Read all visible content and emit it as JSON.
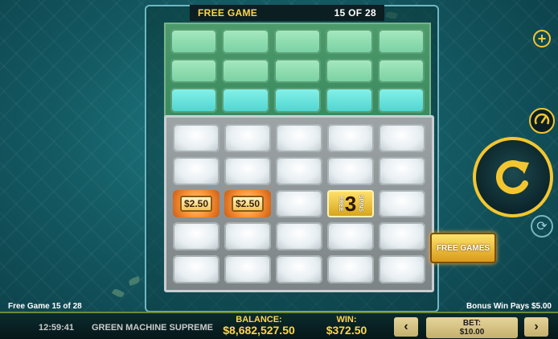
{
  "header": {
    "mode_label": "FREE GAME",
    "progress": "15 OF 28"
  },
  "reels": {
    "prizes": [
      {
        "row": 2,
        "col": 0,
        "label": "$2.50"
      },
      {
        "row": 2,
        "col": 1,
        "label": "$2.50"
      }
    ],
    "spins_symbol": {
      "row": 2,
      "col": 3,
      "number": "3",
      "left_word": "FREE",
      "right_word": "SPINS"
    },
    "free_games_badge": "FREE GAMES"
  },
  "status": {
    "left": "Free Game 15 of 28",
    "right": "Bonus Win Pays $5.00"
  },
  "bottom_bar": {
    "clock": "12:59:41",
    "game_name": "GREEN MACHINE SUPREME",
    "balance_label": "BALANCE:",
    "balance_value": "$8,682,527.50",
    "win_label": "WIN:",
    "win_value": "$372.50",
    "bet_label": "BET:",
    "bet_value": "$10.00",
    "prev_symbol": "‹",
    "next_symbol": "›"
  },
  "controls": {
    "plus_symbol": "+",
    "autoplay_symbol": "⟳"
  },
  "colors": {
    "accent": "#f3c630",
    "gold_text": "#ffd64a",
    "bg": "#145a63"
  },
  "icons": [
    "plus-icon",
    "speedometer-icon",
    "spin-arrow-icon",
    "autoplay-icon",
    "chevron-left-icon",
    "chevron-right-icon"
  ]
}
